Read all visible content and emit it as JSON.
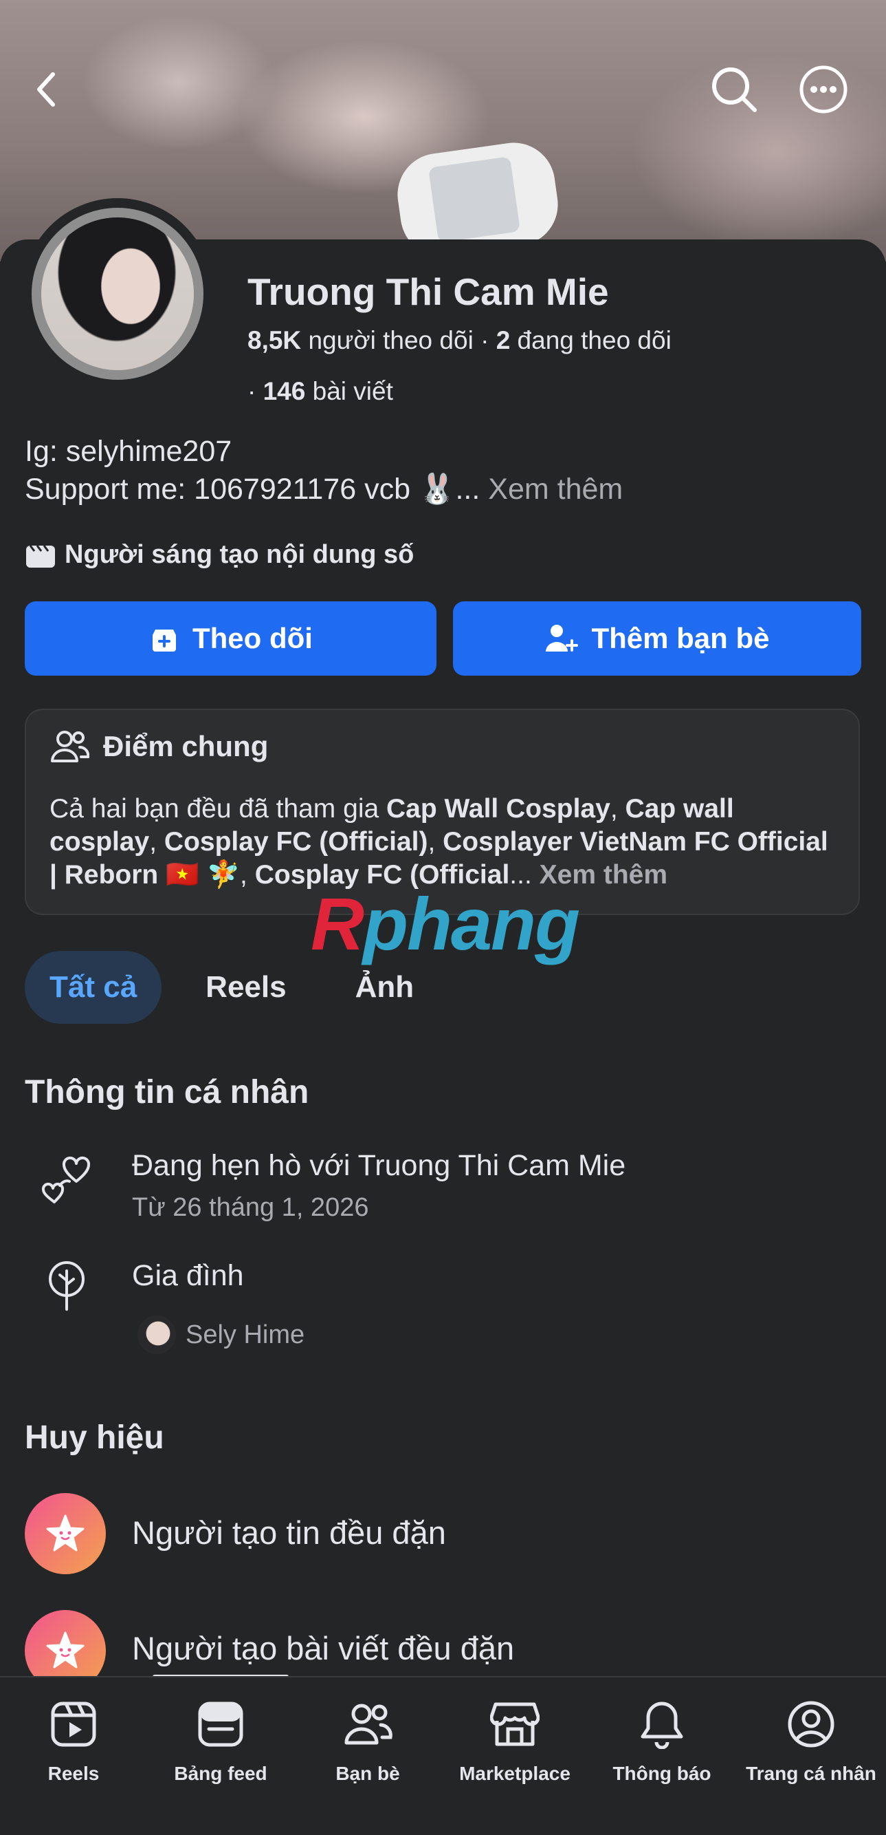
{
  "profile": {
    "name": "Truong Thi Cam Mie",
    "followers_count": "8,5K",
    "followers_label": "người theo dõi",
    "following_count": "2",
    "following_label": "đang theo dõi",
    "posts_count": "146",
    "posts_label": "bài viết"
  },
  "bio": {
    "line1": "Ig: selyhime207",
    "line2": "Support me: 1067921176 vcb 🐰...",
    "see_more": "Xem thêm"
  },
  "category": "Người sáng tạo nội dung số",
  "actions": {
    "follow_label": "Theo dõi",
    "add_friend_label": "Thêm bạn bè"
  },
  "common": {
    "title": "Điểm chung",
    "prefix": "Cả hai bạn đều đã tham gia ",
    "group1": "Cap Wall Cosplay",
    "sep1": ", ",
    "group2": "Cap wall cosplay",
    "sep2": ", ",
    "group3": "Cosplay FC (Official)",
    "sep3": ", ",
    "group4": "Cosplayer VietNam FC Official | Reborn 🇻🇳 🧚",
    "sep4": ", ",
    "group5": "Cosplay FC (Official",
    "ellipsis": "...",
    "see_more": "Xem thêm"
  },
  "watermark": {
    "r": "R",
    "rest": "phang"
  },
  "tabs": [
    {
      "label": "Tất cả",
      "active": true
    },
    {
      "label": "Reels",
      "active": false
    },
    {
      "label": "Ảnh",
      "active": false
    }
  ],
  "personal_info": {
    "title": "Thông tin cá nhân",
    "relationship": "Đang hẹn hò với Truong Thi Cam Mie",
    "relationship_since": "Từ 26 tháng 1, 2026",
    "family_label": "Gia đình",
    "family_member": "Sely Hime"
  },
  "badges": {
    "title": "Huy hiệu",
    "items": [
      "Người tạo tin đều đặn",
      "Người tạo bài viết đều đặn"
    ]
  },
  "bottom_nav": [
    {
      "label": "Reels",
      "icon": "reels-icon"
    },
    {
      "label": "Bảng feed",
      "icon": "feed-icon"
    },
    {
      "label": "Bạn bè",
      "icon": "friends-icon"
    },
    {
      "label": "Marketplace",
      "icon": "marketplace-icon"
    },
    {
      "label": "Thông báo",
      "icon": "bell-icon"
    },
    {
      "label": "Trang cá nhân",
      "icon": "profile-icon"
    }
  ],
  "colors": {
    "background": "#242526",
    "primary_button": "#1f6bf1",
    "active_tab_bg": "#263951",
    "active_tab_text": "#5aa7ff",
    "secondary_text": "#a8abaf"
  }
}
